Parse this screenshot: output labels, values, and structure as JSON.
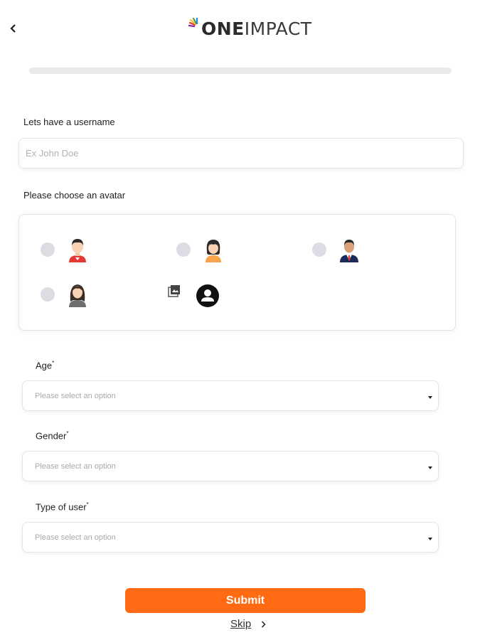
{
  "header": {
    "back_icon": "chevron-left-icon",
    "logo": {
      "part_bold": "ONE",
      "part_light": "IMPACT"
    }
  },
  "progress": {
    "value_percent": 0,
    "color": "#e9e9ec"
  },
  "username": {
    "label": "Lets have a username",
    "placeholder": "Ex John Doe",
    "value": ""
  },
  "avatar": {
    "label": "Please choose an avatar",
    "options": [
      {
        "icon": "male-avatar-icon",
        "selected": false
      },
      {
        "icon": "female-avatar-icon",
        "selected": false
      },
      {
        "icon": "businessman-avatar-icon",
        "selected": false
      },
      {
        "icon": "woman-long-hair-avatar-icon",
        "selected": false
      }
    ],
    "upload_icon": "gallery-icon",
    "profile_icon": "profile-icon"
  },
  "fields": [
    {
      "label": "Age",
      "required_mark": "*",
      "placeholder": "Please select an option"
    },
    {
      "label": "Gender",
      "required_mark": "*",
      "placeholder": "Please select an option"
    },
    {
      "label": "Type of user",
      "required_mark": "*",
      "placeholder": "Please select an option"
    }
  ],
  "actions": {
    "submit_label": "Submit",
    "skip_label": "Skip"
  },
  "colors": {
    "accent": "#ff6a13",
    "radio": "#dcdde2",
    "border": "#e4e4e8"
  }
}
